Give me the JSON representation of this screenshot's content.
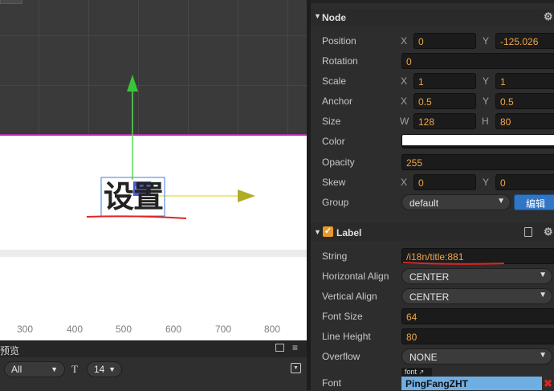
{
  "scene": {
    "ruler_ticks": [
      "300",
      "400",
      "500",
      "600",
      "700",
      "800"
    ],
    "label_text": "设置"
  },
  "console": {
    "title": "预览",
    "filter_value": "All",
    "font_size_value": "14"
  },
  "inspector": {
    "node": {
      "title": "Node",
      "position": {
        "label": "Position",
        "x_axis": "X",
        "x": "0",
        "y_axis": "Y",
        "y": "-125.026"
      },
      "rotation": {
        "label": "Rotation",
        "value": "0"
      },
      "scale": {
        "label": "Scale",
        "x_axis": "X",
        "x": "1",
        "y_axis": "Y",
        "y": "1"
      },
      "anchor": {
        "label": "Anchor",
        "x_axis": "X",
        "x": "0.5",
        "y_axis": "Y",
        "y": "0.5"
      },
      "size": {
        "label": "Size",
        "w_axis": "W",
        "w": "128",
        "h_axis": "H",
        "h": "80"
      },
      "color": {
        "label": "Color",
        "value": "#ffffff"
      },
      "opacity": {
        "label": "Opacity",
        "value": "255"
      },
      "skew": {
        "label": "Skew",
        "x_axis": "X",
        "x": "0",
        "y_axis": "Y",
        "y": "0"
      },
      "group": {
        "label": "Group",
        "value": "default",
        "edit_label": "编辑"
      }
    },
    "label": {
      "title": "Label",
      "string": {
        "label": "String",
        "value": "/i18n/title:881"
      },
      "h_align": {
        "label": "Horizontal Align",
        "value": "CENTER"
      },
      "v_align": {
        "label": "Vertical Align",
        "value": "CENTER"
      },
      "font_size": {
        "label": "Font Size",
        "value": "64"
      },
      "line_height": {
        "label": "Line Height",
        "value": "80"
      },
      "overflow": {
        "label": "Overflow",
        "value": "NONE"
      },
      "font": {
        "label": "Font",
        "tag": "font",
        "value": "PingFangZHT"
      }
    }
  }
}
